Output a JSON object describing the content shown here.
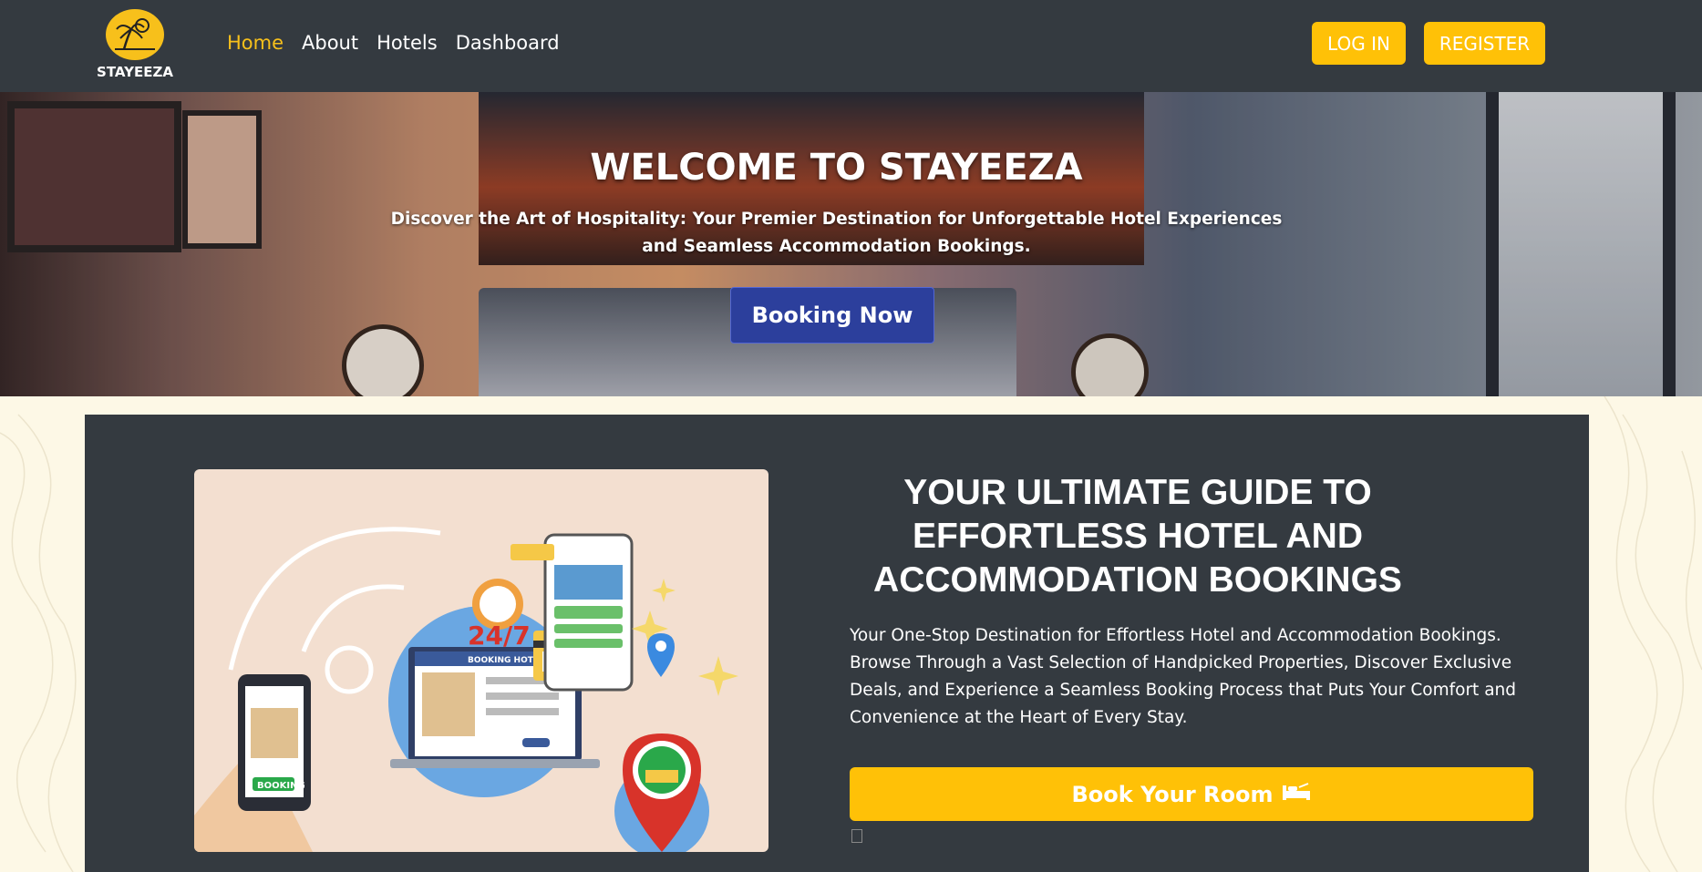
{
  "brand": {
    "name": "STAYEEZA"
  },
  "nav": {
    "links": [
      {
        "label": "Home",
        "active": true
      },
      {
        "label": "About",
        "active": false
      },
      {
        "label": "Hotels",
        "active": false
      },
      {
        "label": "Dashboard",
        "active": false
      }
    ],
    "login_label": "LOG IN",
    "register_label": "REGISTER"
  },
  "hero": {
    "title": "WELCOME TO STAYEEZA",
    "subtitle": "Discover the Art of Hospitality: Your Premier Destination for Unforgettable Hotel Experiences and Seamless Accommodation Bookings.",
    "cta_label": "Booking Now"
  },
  "guide": {
    "title": "YOUR ULTIMATE GUIDE TO EFFORTLESS HOTEL AND ACCOMMODATION BOOKINGS",
    "description": "Your One-Stop Destination for Effortless Hotel and Accommodation Bookings. Browse Through a Vast Selection of Handpicked Properties, Discover Exclusive Deals, and Experience a Seamless Booking Process that Puts Your Comfort and Convenience at the Heart of Every Stay.",
    "cta_label": "Book Your Room",
    "illustration": {
      "badge": "24/7",
      "laptop_header": "BOOKING HOTEL",
      "phone_label": "BOOKING"
    }
  },
  "colors": {
    "navbar": "#343a40",
    "accent": "#ffc107",
    "primary_button": "#2c3f9c",
    "page_bg": "#fdf8e6"
  }
}
